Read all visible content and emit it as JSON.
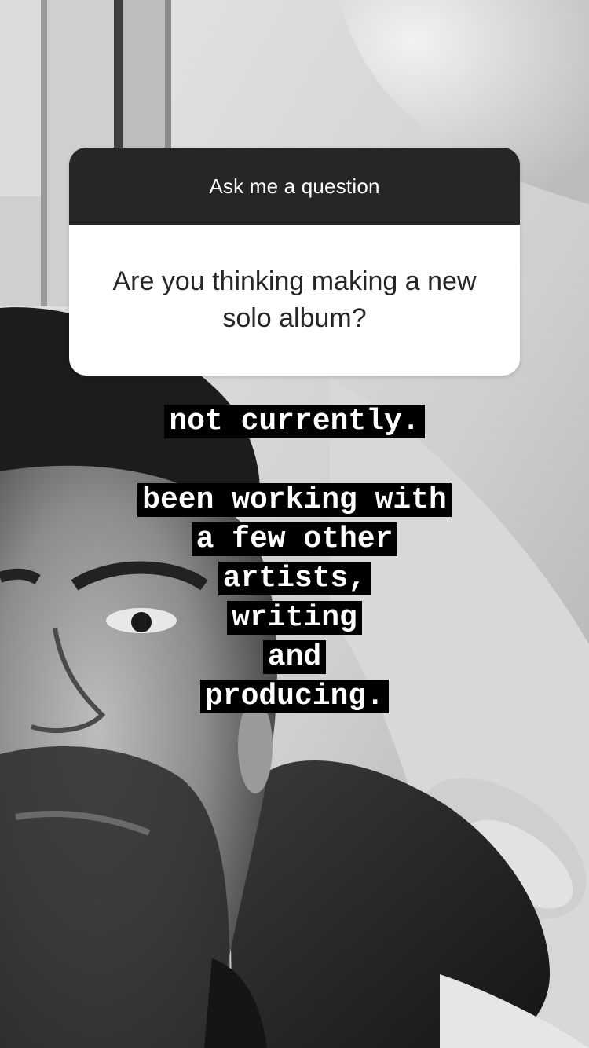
{
  "question_sticker": {
    "header": "Ask me a question",
    "question": "Are you thinking making a new solo album?"
  },
  "reply": {
    "lines": [
      "not currently.",
      "",
      "been working with",
      "a few other",
      "artists,",
      "writing",
      "and",
      "producing."
    ]
  }
}
